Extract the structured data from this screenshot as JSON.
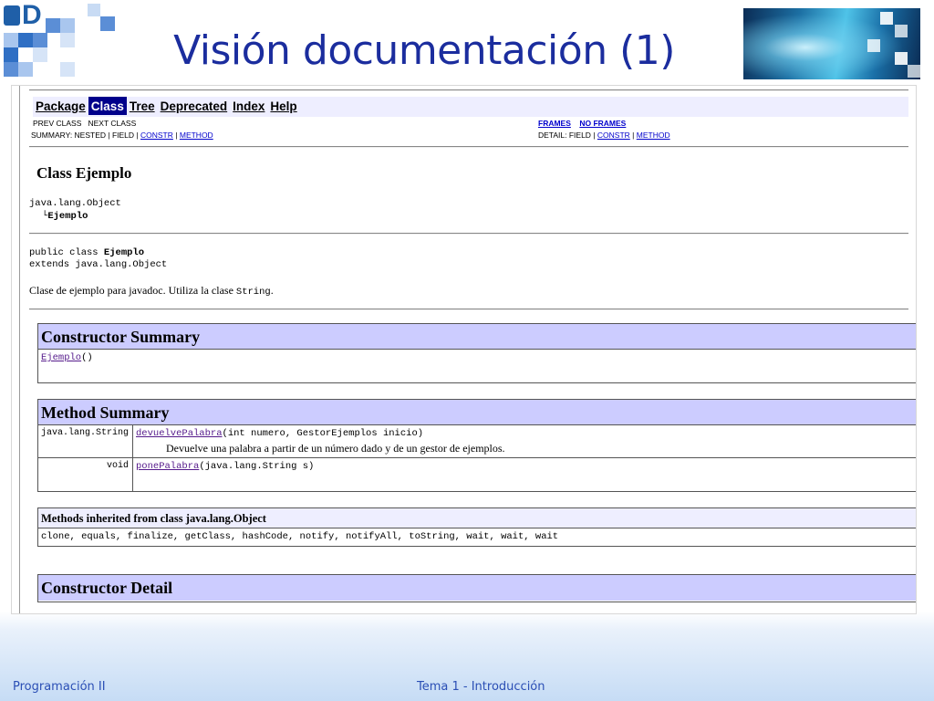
{
  "slide": {
    "title": "Visión documentación (1)",
    "logo_letter": "D",
    "footer_left": "Programación II",
    "footer_center": "Tema 1 - Introducción"
  },
  "navbar": {
    "items": [
      "Package",
      "Class",
      "Tree",
      "Deprecated",
      "Index",
      "Help"
    ],
    "active": "Class"
  },
  "subnav": {
    "prev_class": "PREV CLASS",
    "next_class": "NEXT CLASS",
    "frames": "FRAMES",
    "no_frames": "NO FRAMES",
    "summary_prefix": "SUMMARY: NESTED | FIELD |",
    "summary_constr": "CONSTR",
    "summary_method": "METHOD",
    "detail_prefix": "DETAIL: FIELD |",
    "detail_constr": "CONSTR",
    "detail_method": "METHOD",
    "pipe": "|"
  },
  "class_info": {
    "title": "Class Ejemplo",
    "hierarchy_root": "java.lang.Object",
    "hierarchy_branch": "└",
    "hierarchy_child": "Ejemplo",
    "decl_prefix": "public class ",
    "decl_name": "Ejemplo",
    "extends_line": "extends java.lang.Object",
    "description_text": "Clase de ejemplo para javadoc. Utiliza la clase ",
    "description_code": "String",
    "description_end": "."
  },
  "constructor_summary": {
    "header": "Constructor Summary",
    "link": "Ejemplo",
    "params": "()"
  },
  "method_summary": {
    "header": "Method Summary",
    "rows": [
      {
        "type": "java.lang.String",
        "name": "devuelvePalabra",
        "params": "(int numero, GestorEjemplos inicio)",
        "description": "Devuelve una palabra a partir de un número dado y de un gestor de ejemplos."
      },
      {
        "type": "void",
        "name": "ponePalabra",
        "params": "(java.lang.String s)",
        "description": ""
      }
    ]
  },
  "inherited": {
    "header": "Methods inherited from class java.lang.Object",
    "methods": "clone, equals, finalize, getClass, hashCode, notify, notifyAll, toString, wait, wait, wait"
  },
  "constructor_detail": {
    "header": "Constructor Detail"
  },
  "colors": {
    "title": "#1b2d9e",
    "nav_active": "#00008b",
    "table_header": "#ccccff",
    "sub_header": "#eeeeff",
    "footer_text": "#2b4fb5"
  }
}
